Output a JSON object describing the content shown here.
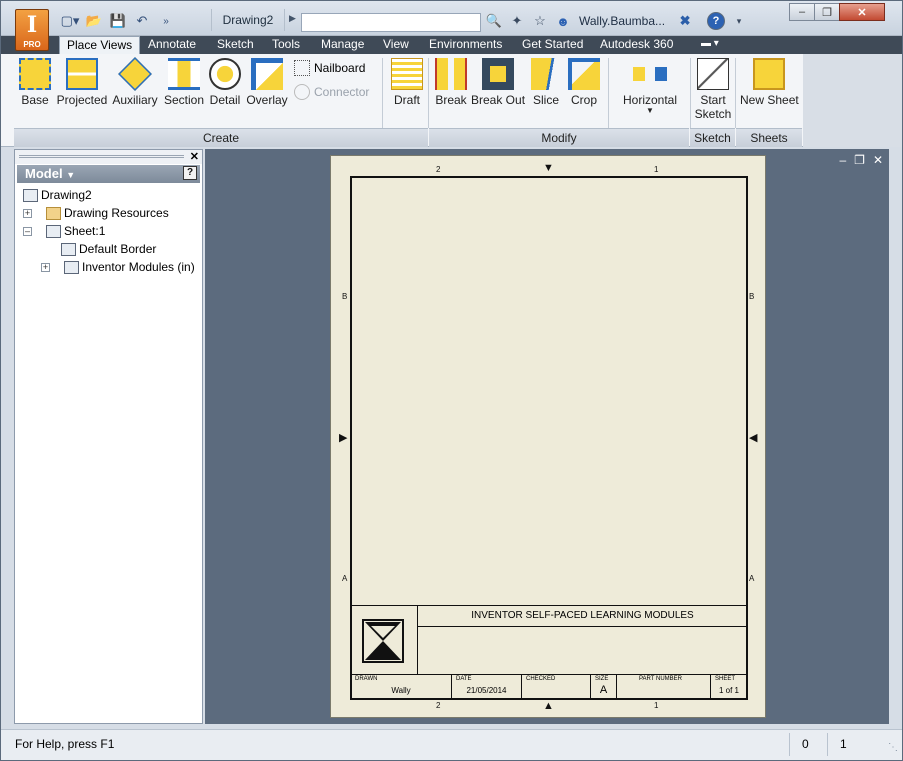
{
  "app": {
    "badge": "PRO",
    "document_title": "Drawing2",
    "search_placeholder": "",
    "user_name": "Wally.Baumba...",
    "accent": "#e2771f"
  },
  "tabs": [
    {
      "label": "Place Views",
      "active": true
    },
    {
      "label": "Annotate"
    },
    {
      "label": "Sketch"
    },
    {
      "label": "Tools"
    },
    {
      "label": "Manage"
    },
    {
      "label": "View"
    },
    {
      "label": "Environments"
    },
    {
      "label": "Get Started"
    },
    {
      "label": "Autodesk 360"
    }
  ],
  "ribbon": {
    "create": {
      "label": "Create",
      "base": "Base",
      "projected": "Projected",
      "auxiliary": "Auxiliary",
      "section": "Section",
      "detail": "Detail",
      "overlay": "Overlay",
      "nailboard": "Nailboard",
      "connector": "Connector",
      "draft": "Draft"
    },
    "modify": {
      "label": "Modify",
      "break": "Break",
      "break_out": "Break Out",
      "slice": "Slice",
      "crop": "Crop",
      "horizontal": "Horizontal"
    },
    "sketch": {
      "label": "Sketch",
      "start": "Start",
      "sketch": "Sketch"
    },
    "sheets": {
      "label": "Sheets",
      "new_sheet": "New Sheet"
    }
  },
  "browser": {
    "header": "Model",
    "help": "?",
    "tree": {
      "root": "Drawing2",
      "resources": "Drawing Resources",
      "sheet": "Sheet:1",
      "border": "Default Border",
      "modules": "Inventor Modules (in)"
    }
  },
  "sheet": {
    "zones_top": [
      "2",
      "1"
    ],
    "zones_side": [
      "B",
      "A"
    ],
    "title": "INVENTOR SELF-PACED LEARNING MODULES",
    "drawn_label": "DRAWN",
    "drawn_value": "Wally",
    "date_label": "DATE",
    "date_value": "21/05/2014",
    "checked_label": "CHECKED",
    "size_label": "SIZE",
    "size_value": "A",
    "part_label": "PART NUMBER",
    "sheet_label": "SHEET",
    "sheet_value": "1  of 1"
  },
  "status": {
    "help_text": "For Help, press F1",
    "field1": "0",
    "field2": "1"
  }
}
